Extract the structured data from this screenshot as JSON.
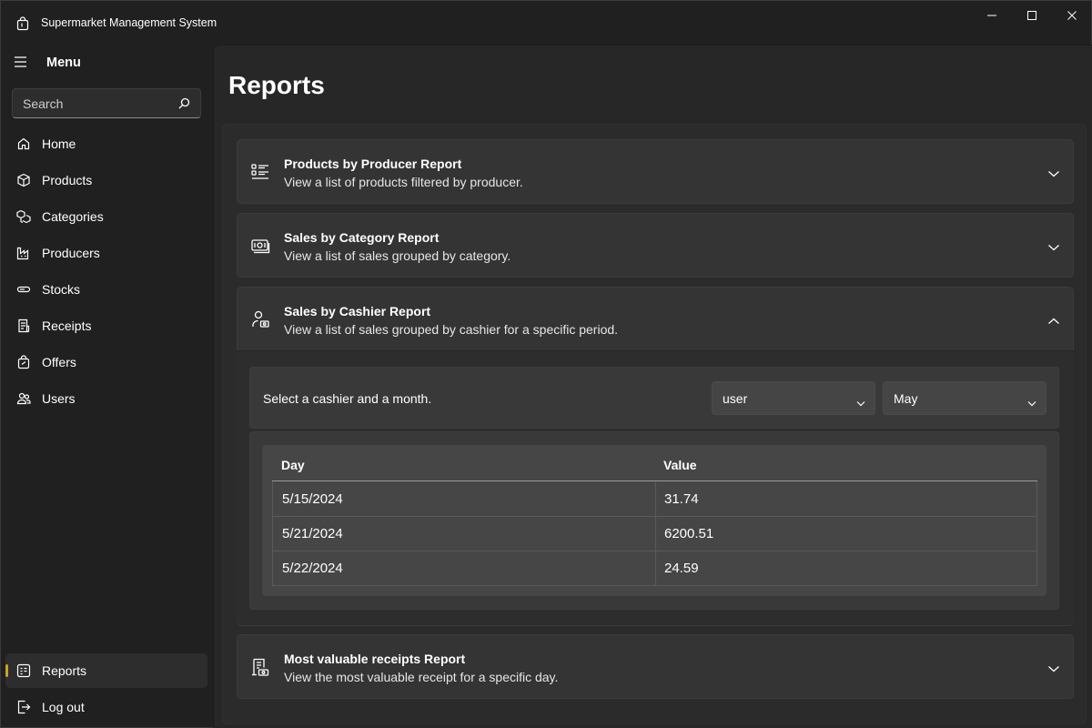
{
  "app": {
    "title": "Supermarket Management System"
  },
  "sidebar": {
    "menu_label": "Menu",
    "search_placeholder": "Search",
    "items": [
      {
        "label": "Home",
        "icon": "home-icon"
      },
      {
        "label": "Products",
        "icon": "box-icon"
      },
      {
        "label": "Categories",
        "icon": "boxes-icon"
      },
      {
        "label": "Producers",
        "icon": "factory-icon"
      },
      {
        "label": "Stocks",
        "icon": "stock-icon"
      },
      {
        "label": "Receipts",
        "icon": "receipt-icon"
      },
      {
        "label": "Offers",
        "icon": "shopping-bag-icon"
      },
      {
        "label": "Users",
        "icon": "users-icon"
      }
    ],
    "footer_items": [
      {
        "label": "Reports",
        "icon": "report-icon",
        "active": true
      },
      {
        "label": "Log out",
        "icon": "logout-icon"
      }
    ],
    "active_indicator_color": "#c9a227"
  },
  "page": {
    "title": "Reports"
  },
  "reports": [
    {
      "title": "Products by Producer Report",
      "description": "View a list of products filtered by producer.",
      "icon": "list-icon",
      "expanded": false
    },
    {
      "title": "Sales by Category Report",
      "description": "View a list of sales grouped by category.",
      "icon": "money-icon",
      "expanded": false
    },
    {
      "title": "Sales by Cashier Report",
      "description": "View a list of sales grouped by cashier for a specific period.",
      "icon": "cashier-icon",
      "expanded": true,
      "filter_prompt": "Select a cashier and a month.",
      "cashier_value": "user",
      "month_value": "May",
      "columns": [
        "Day",
        "Value"
      ],
      "rows": [
        {
          "day": "5/15/2024",
          "value": "31.74"
        },
        {
          "day": "5/21/2024",
          "value": "6200.51"
        },
        {
          "day": "5/22/2024",
          "value": "24.59"
        }
      ]
    },
    {
      "title": "Most valuable receipts Report",
      "description": "View the most valuable receipt for a specific day.",
      "icon": "receipt-money-icon",
      "expanded": false
    }
  ]
}
